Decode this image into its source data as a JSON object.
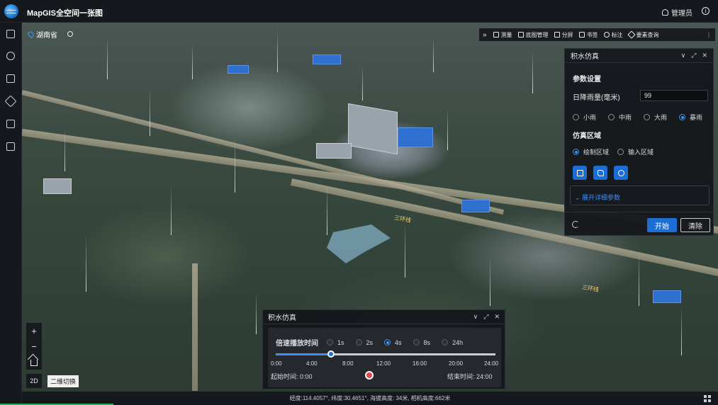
{
  "app": {
    "title": "MapGIS全空间一张图",
    "user": "管理员"
  },
  "location": {
    "name": "湖南省"
  },
  "toolbar": {
    "items": [
      {
        "label": "测量",
        "icon": "ruler-icon"
      },
      {
        "label": "底图管理",
        "icon": "grid-icon"
      },
      {
        "label": "分屏",
        "icon": "split-screen-icon"
      },
      {
        "label": "书签",
        "icon": "bookmark-icon"
      },
      {
        "label": "标注",
        "icon": "pin-icon"
      },
      {
        "label": "要素查询",
        "icon": "pentagon-icon"
      }
    ]
  },
  "flood_panel": {
    "title": "积水仿真",
    "params_title": "参数设置",
    "rainfall_label": "日降雨量(毫米)",
    "rainfall_value": "99",
    "rain_levels": [
      "小雨",
      "中雨",
      "大雨",
      "暴雨"
    ],
    "rain_selected": 3,
    "region_title": "仿真区域",
    "region_options": [
      "绘制区域",
      "输入区域"
    ],
    "region_selected": 0,
    "expand_label": "展开详细参数",
    "start_label": "开始",
    "clear_label": "清除"
  },
  "playback_panel": {
    "title": "积水仿真",
    "speed_label": "倍速播放时间",
    "speeds": [
      "1s",
      "2s",
      "4s",
      "8s",
      "24h"
    ],
    "speed_selected": 2,
    "ticks": [
      "0:00",
      "4:00",
      "8:00",
      "12:00",
      "16:00",
      "20:00",
      "24:00"
    ],
    "progress": 0.25,
    "start_time_label": "起始时间:",
    "start_time": "0:00",
    "end_time_label": "结束时间:",
    "end_time": "24:00"
  },
  "map_controls": {
    "zoom_in": "+",
    "zoom_out": "−",
    "mode": "2D",
    "mode_tooltip": "二维切换"
  },
  "status": {
    "text": "经度:114.4057°, 纬度:30.4651°, 海拔高度: 34米, 相机高度:662米"
  },
  "colors": {
    "accent": "#1b6fd4",
    "panel_bg": "#15181c",
    "selected": "#3d8ff0"
  },
  "map_labels": [
    "三环线",
    "三环线"
  ]
}
